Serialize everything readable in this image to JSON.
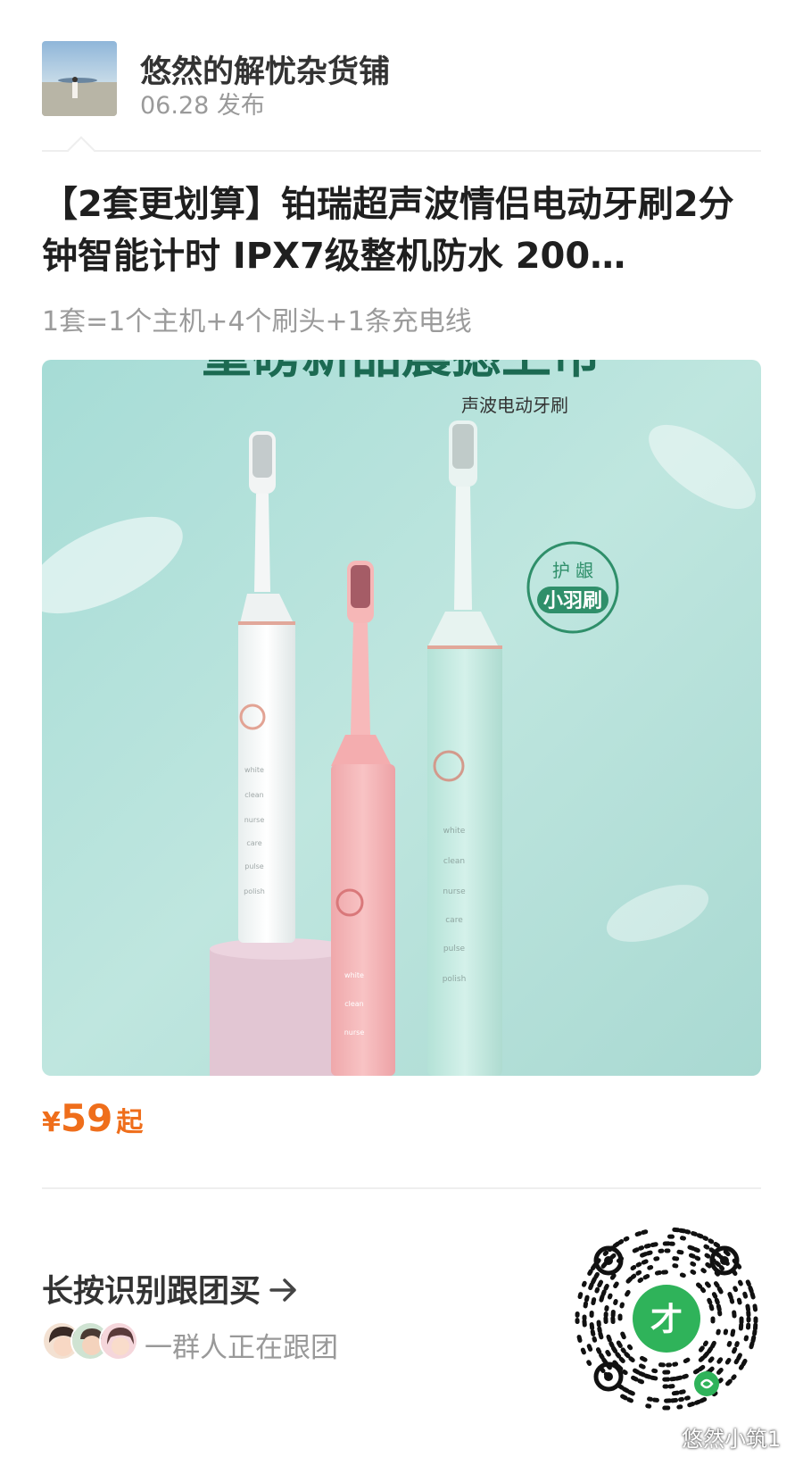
{
  "post": {
    "shop_name": "悠然的解忧杂货铺",
    "publish_date": "06.28 发布"
  },
  "product": {
    "title": "【2套更划算】铂瑞超声波情侣电动牙刷2分钟智能计时 IPX7级整机防水 200…",
    "subtitle": "1套=1个主机+4个刷头+1条充电线",
    "image_banner_text": "重磅新品震撼上市",
    "image_caption": "声波电动牙刷",
    "badge_line1": "护  龈",
    "badge_line2": "小羽刷",
    "mode_labels": [
      "white",
      "clean",
      "nurse",
      "care",
      "pulse",
      "polish"
    ]
  },
  "price": {
    "currency": "¥",
    "amount": "59",
    "suffix": "起"
  },
  "cta": {
    "label": "长按识别跟团买",
    "group_text": "一群人正在跟团"
  },
  "watermark": {
    "text": "悠然小筑1"
  },
  "colors": {
    "price": "#ef6e1b",
    "qr_center": "#2fb35a"
  }
}
